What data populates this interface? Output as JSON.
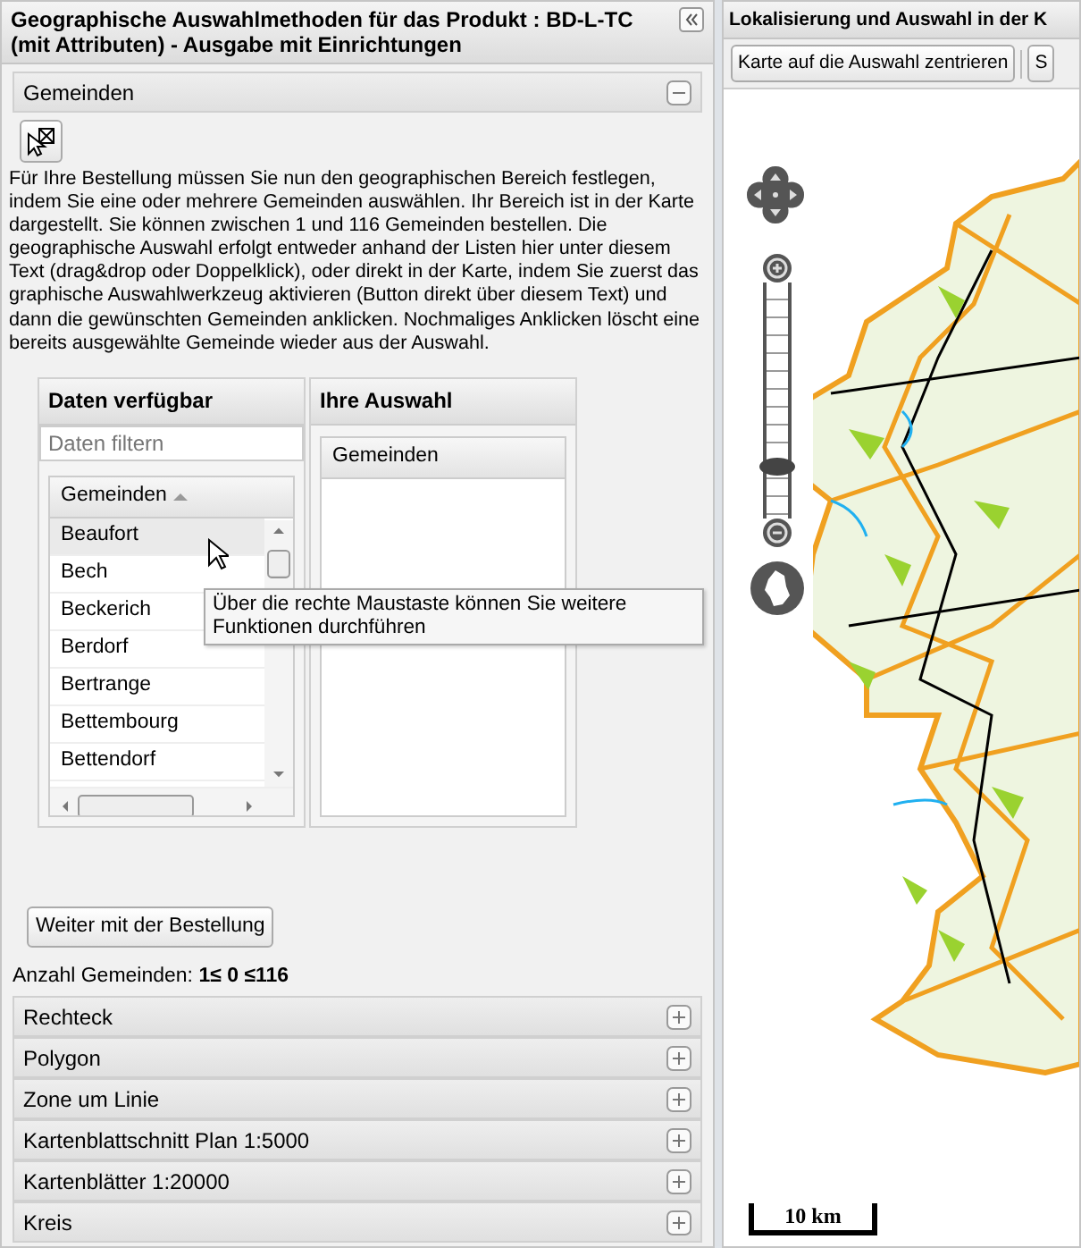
{
  "left_panel": {
    "title": "Geographische Auswahlmethoden für das Produkt : BD-L-TC (mit Attributen) - Ausgabe mit Einrichtungen",
    "sections": [
      {
        "title": "Gemeinden",
        "expanded": true,
        "description": "Für Ihre Bestellung müssen Sie nun den geographischen Bereich festlegen, indem Sie eine oder mehrere Gemeinden auswählen. Ihr Bereich ist in der Karte dargestellt. Sie können zwischen 1 und 116 Gemeinden bestellen. Die geographische Auswahl erfolgt entweder anhand der Listen hier unter diesem Text (drag&drop oder Doppelklick), oder direkt in der Karte, indem Sie zuerst das graphische Auswahlwerkzeug aktivieren (Button direkt über diesem Text) und dann die gewünschten Gemeinden anklicken. Nochmaliges Anklicken löscht eine bereits ausgewählte Gemeinde wieder aus der Auswahl.",
        "available": {
          "title": "Daten verfügbar",
          "filter_placeholder": "Daten filtern",
          "column": "Gemeinden",
          "rows": [
            {
              "name": "Beaufort",
              "hovered": true
            },
            {
              "name": "Bech",
              "hovered": false
            },
            {
              "name": "Beckerich",
              "hovered": false
            },
            {
              "name": "Berdorf",
              "hovered": false
            },
            {
              "name": "Bertrange",
              "hovered": false
            },
            {
              "name": "Bettembourg",
              "hovered": false
            },
            {
              "name": "Bettendorf",
              "hovered": false
            }
          ]
        },
        "tooltip": "Über die rechte Maustaste können Sie weitere Funktionen durchführen",
        "selection": {
          "title": "Ihre Auswahl",
          "column": "Gemeinden"
        },
        "continue_button": "Weiter mit der Bestellung",
        "count": "Anzahl Gemeinden: **1≤ 0 ≤116**"
      },
      {
        "title": "Rechteck",
        "expanded": false
      },
      {
        "title": "Polygon",
        "expanded": false
      },
      {
        "title": "Zone um Linie",
        "expanded": false
      },
      {
        "title": "Kartenblattschnitt Plan 1:5000",
        "expanded": false
      },
      {
        "title": "Kartenblätter 1:20000",
        "expanded": false
      },
      {
        "title": "Kreis",
        "expanded": false
      }
    ]
  },
  "map_panel": {
    "title": "Lokalisierung und Auswahl in der K",
    "toolbar": [
      "Karte auf die Auswahl zentrieren",
      "S"
    ],
    "zoom": {
      "level": 0.2
    },
    "scale": "10 km"
  }
}
